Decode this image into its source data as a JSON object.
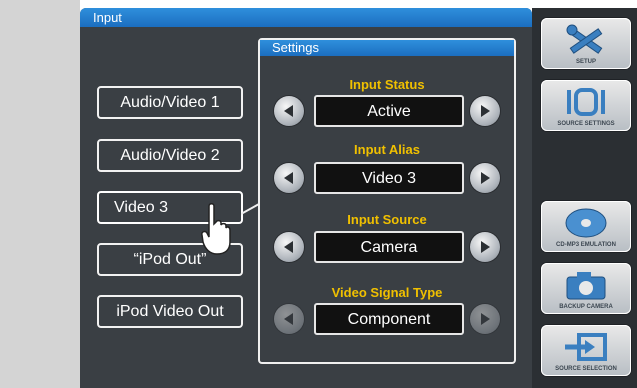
{
  "window": {
    "title": "Input"
  },
  "sources": [
    {
      "label": "Audio/Video 1"
    },
    {
      "label": "Audio/Video 2"
    },
    {
      "label": "Video 3"
    },
    {
      "label": "“iPod Out”"
    },
    {
      "label": "iPod Video Out"
    }
  ],
  "settings": {
    "title": "Settings",
    "rows": [
      {
        "label": "Input Status",
        "value": "Active"
      },
      {
        "label": "Input Alias",
        "value": "Video 3"
      },
      {
        "label": "Input Source",
        "value": "Camera"
      },
      {
        "label": "Video Signal Type",
        "value": "Component"
      }
    ]
  },
  "side_buttons": [
    {
      "label": "SETUP",
      "icon": "tools-icon"
    },
    {
      "label": "SOURCE SETTINGS",
      "icon": "source-settings-icon"
    },
    {
      "label": "CD-MP3 EMULATION",
      "icon": "disc-icon"
    },
    {
      "label": "BACKUP CAMERA",
      "icon": "camera-icon"
    },
    {
      "label": "SOURCE SELECTION",
      "icon": "source-selection-icon"
    }
  ],
  "colors": {
    "header_blue": "#1b6ec0",
    "label_yellow": "#f0c000",
    "panel": "#3a3f44"
  }
}
